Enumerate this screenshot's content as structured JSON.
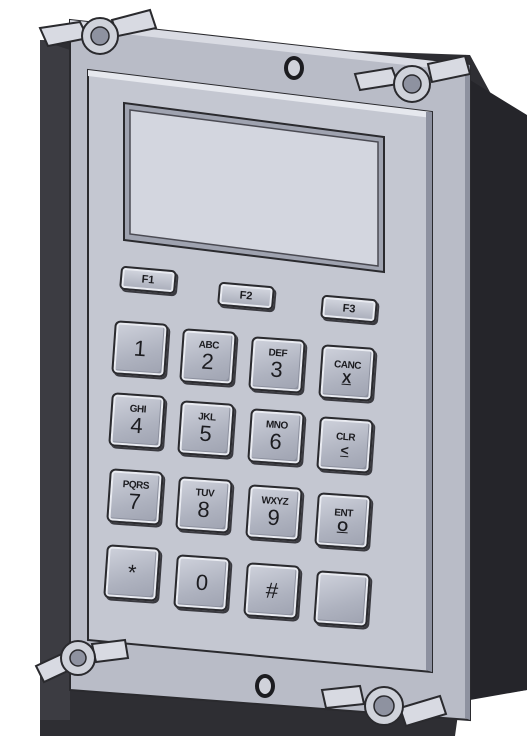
{
  "keypad": {
    "function_keys": [
      {
        "label": "F1"
      },
      {
        "label": "F2"
      },
      {
        "label": "F3"
      }
    ],
    "keys": [
      {
        "main": "1",
        "sub": ""
      },
      {
        "main": "2",
        "sub": "ABC"
      },
      {
        "main": "3",
        "sub": "DEF"
      },
      {
        "main": "X",
        "sub": "CANC"
      },
      {
        "main": "4",
        "sub": "GHI"
      },
      {
        "main": "5",
        "sub": "JKL"
      },
      {
        "main": "6",
        "sub": "MNO"
      },
      {
        "main": "<",
        "sub": "CLR"
      },
      {
        "main": "7",
        "sub": "PQRS"
      },
      {
        "main": "8",
        "sub": "TUV"
      },
      {
        "main": "9",
        "sub": "WXYZ"
      },
      {
        "main": "O",
        "sub": "ENT"
      },
      {
        "main": "*",
        "sub": ""
      },
      {
        "main": "0",
        "sub": ""
      },
      {
        "main": "#",
        "sub": ""
      },
      {
        "main": "",
        "sub": ""
      }
    ]
  },
  "colors": {
    "housing": "#3b3b40",
    "faceplate": "#c3c6d0",
    "frame": "#b8bbc6",
    "display": "#d2d5de",
    "wingnut": "#d8dae2"
  }
}
